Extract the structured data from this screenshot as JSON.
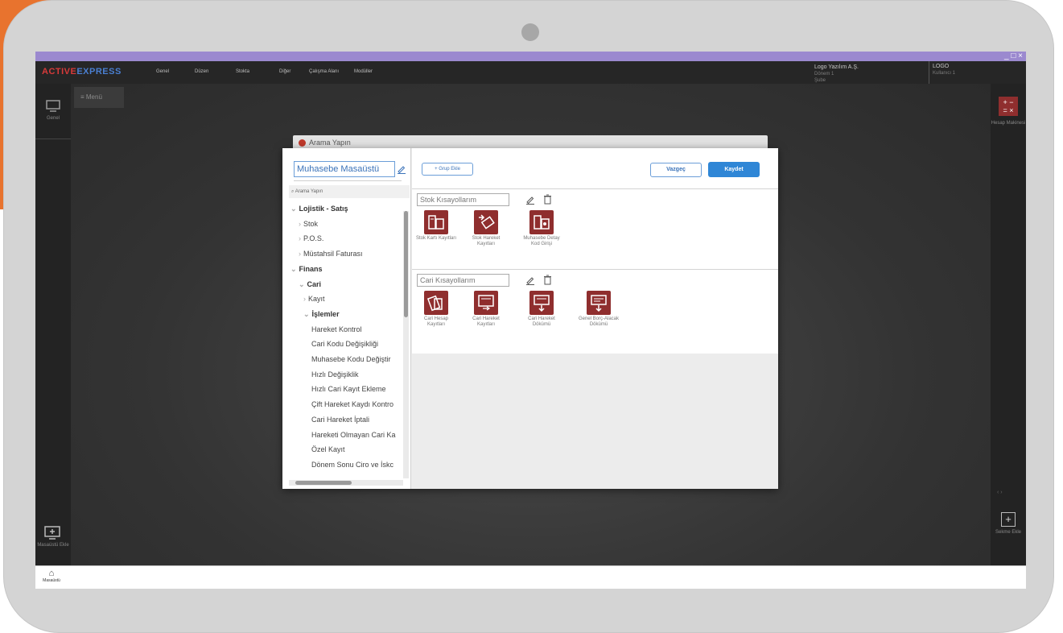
{
  "app": {
    "logo_part1": "ACTIVE",
    "logo_part2": "EXPRESS",
    "window_controls": "_ □ ×",
    "menus": [
      "Genel",
      "Düzen",
      "Stokta",
      "Diğer",
      "Çalışma Alanı",
      "Modüller"
    ],
    "company": "Logo Yazılım A.Ş.",
    "company_sub1": "Dönem 1",
    "company_sub2": "Şube",
    "user": "LOGO",
    "user_sub": "Kullanıcı 1"
  },
  "left_rail": {
    "top_label": "Genel",
    "bottom_label": "Masaüstü Ekle"
  },
  "right_rail": {
    "calc_label": "Hesap Makinesi",
    "add_label": "Sekme Ekle"
  },
  "workspace": {
    "menu_label": "≡ Menü"
  },
  "taskbar": {
    "home_label": "Masaüstü"
  },
  "background_search": {
    "text": "Arama Yapın"
  },
  "dialog": {
    "desktop_name": "Muhasebe Masaüstü",
    "search_placeholder": "Arama Yapın",
    "tree": [
      {
        "label": "Lojistik - Satış",
        "level": 0,
        "prefix": "⌄"
      },
      {
        "label": "Stok",
        "level": 1,
        "prefix": "›"
      },
      {
        "label": "P.O.S.",
        "level": 1,
        "prefix": "›"
      },
      {
        "label": "Müstahsil Faturası",
        "level": 1,
        "prefix": "›"
      },
      {
        "label": "Finans",
        "level": 0,
        "prefix": "⌄"
      },
      {
        "label": "Cari",
        "level": 1,
        "prefix": "⌄"
      },
      {
        "label": "Kayıt",
        "level": 2,
        "prefix": "›"
      },
      {
        "label": "İşlemler",
        "level": 2,
        "prefix": "⌄"
      },
      {
        "label": "Hareket Kontrol",
        "level": 3,
        "prefix": ""
      },
      {
        "label": "Cari Kodu Değişikliği",
        "level": 3,
        "prefix": ""
      },
      {
        "label": "Muhasebe Kodu Değiştir",
        "level": 3,
        "prefix": ""
      },
      {
        "label": "Hızlı Değişiklik",
        "level": 3,
        "prefix": ""
      },
      {
        "label": "Hızlı Cari Kayıt Ekleme",
        "level": 3,
        "prefix": ""
      },
      {
        "label": "Çift Hareket Kaydı Kontro",
        "level": 3,
        "prefix": ""
      },
      {
        "label": "Cari Hareket İptali",
        "level": 3,
        "prefix": ""
      },
      {
        "label": "Hareketi Olmayan Cari Ka",
        "level": 3,
        "prefix": ""
      },
      {
        "label": "Özel Kayıt",
        "level": 3,
        "prefix": ""
      },
      {
        "label": "Dönem Sonu Ciro ve İskc",
        "level": 3,
        "prefix": ""
      }
    ],
    "group_add_label": "+ Grup Ekle",
    "cancel_label": "Vazgeç",
    "save_label": "Kaydet",
    "groups": [
      {
        "title": "Stok Kısayollarım",
        "shortcuts": [
          {
            "label": "Stok Kartı Kayıtları",
            "icon": "stock-card-icon"
          },
          {
            "label": "Stok Hareket Kayıtları",
            "icon": "stock-movement-icon"
          },
          {
            "label": "Muhasebe Detay Kod Girişi",
            "icon": "accounting-code-icon"
          }
        ]
      },
      {
        "title": "Cari Kısayollarım",
        "shortcuts": [
          {
            "label": "Cari Hesap Kayıtları",
            "icon": "current-account-icon"
          },
          {
            "label": "Cari Hareket Kayıtları",
            "icon": "current-movement-icon"
          },
          {
            "label": "Cari Hareket Dökümü",
            "icon": "movement-report-icon"
          },
          {
            "label": "Genel Borç-Alacak Dökümü",
            "icon": "debt-credit-report-icon"
          }
        ]
      }
    ]
  },
  "colors": {
    "titlebar": "#9b89cf",
    "accent_blue": "#2f86d6",
    "tile_red": "#8f2e2e",
    "orange_bg": "#e8732e"
  }
}
